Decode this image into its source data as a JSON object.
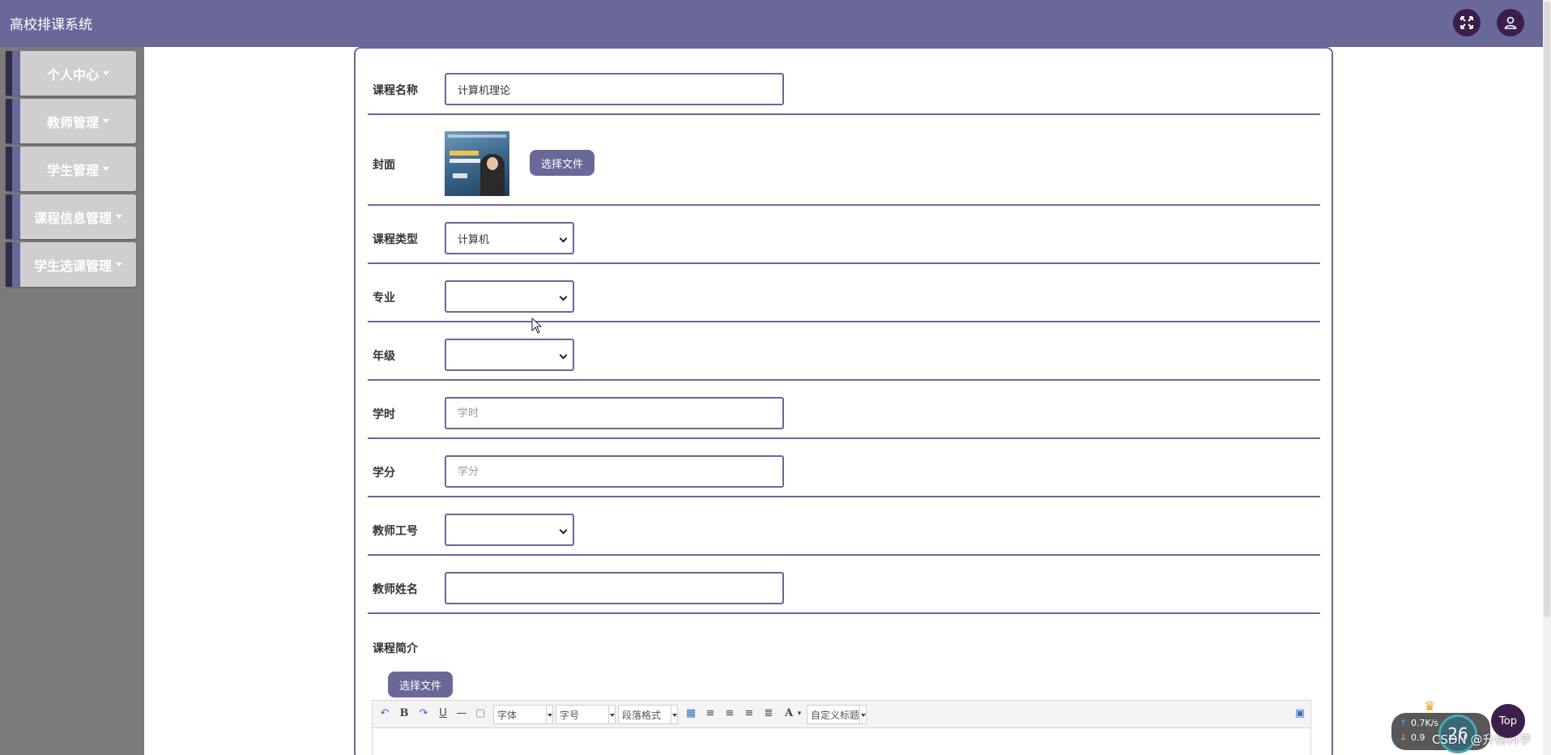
{
  "app": {
    "title": "高校排课系统"
  },
  "sidebar": {
    "items": [
      {
        "label": "个人中心"
      },
      {
        "label": "教师管理"
      },
      {
        "label": "学生管理"
      },
      {
        "label": "课程信息管理"
      },
      {
        "label": "学生选课管理"
      }
    ]
  },
  "form": {
    "course_name": {
      "label": "课程名称",
      "value": "计算机理论"
    },
    "cover": {
      "label": "封面",
      "button": "选择文件"
    },
    "course_type": {
      "label": "课程类型",
      "value": "计算机"
    },
    "major": {
      "label": "专业",
      "value": ""
    },
    "grade": {
      "label": "年级",
      "value": ""
    },
    "hours": {
      "label": "学时",
      "placeholder": "学时"
    },
    "credits": {
      "label": "学分",
      "placeholder": "学分"
    },
    "teacher_id": {
      "label": "教师工号",
      "value": ""
    },
    "teacher_name": {
      "label": "教师姓名",
      "value": ""
    },
    "intro": {
      "label": "课程简介",
      "button": "选择文件"
    }
  },
  "editor": {
    "font_label": "字体",
    "size_label": "字号",
    "paragraph_label": "段落格式",
    "custom_title_label": "自定义标题",
    "font_color_glyph": "A"
  },
  "widgets": {
    "top_label": "Top",
    "upload_speed": "0.7K/s",
    "download_speed": "0.9",
    "percent": "26",
    "watermark": "CSDN @升榜科学"
  }
}
